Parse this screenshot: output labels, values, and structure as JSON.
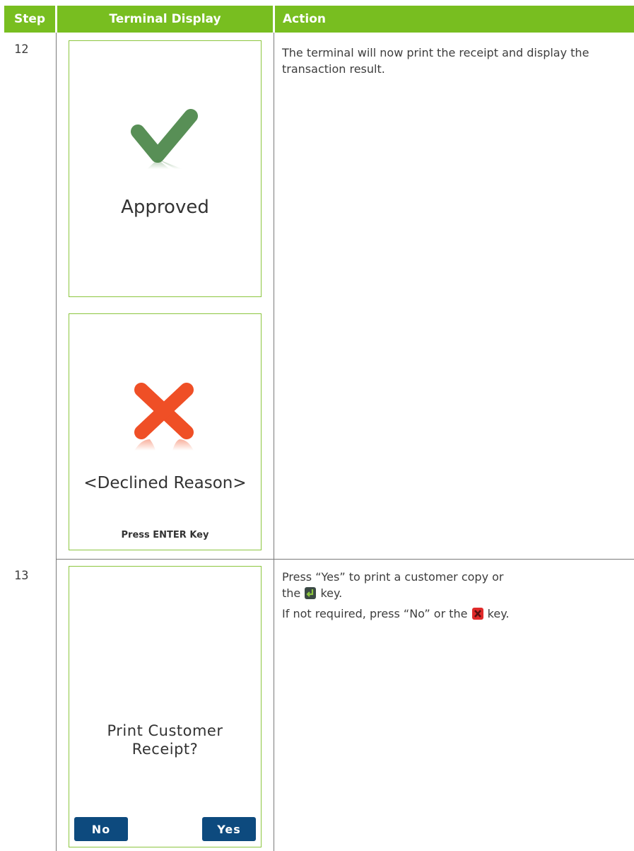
{
  "header": {
    "step": "Step",
    "terminal_display": "Terminal Display",
    "action": "Action"
  },
  "rows": [
    {
      "step": "12",
      "screens": [
        {
          "icon": "checkmark-icon",
          "message": "Approved"
        },
        {
          "icon": "cross-icon",
          "message": "<Declined Reason>",
          "footer": "Press ENTER Key"
        }
      ],
      "action_lines": [
        "The terminal will now print the receipt and display the transaction result."
      ]
    },
    {
      "step": "13",
      "screen": {
        "message_line1": "Print Customer",
        "message_line2": "Receipt?",
        "buttons": {
          "no": "No",
          "yes": "Yes"
        }
      },
      "action": {
        "line1_before": "Press “Yes” to print a customer copy or",
        "line2_before": "the",
        "line2_after": "key.",
        "line3_before": "If not required, press “No” or the",
        "line3_after": "key."
      }
    }
  ],
  "colors": {
    "header": "#78be20",
    "screen_border": "#8cc63f",
    "check": "#4f8a4d",
    "cross": "#f04e23",
    "button": "#0d4a7e",
    "enter_key": "#3b4a45",
    "cancel_key": "#e02a2a"
  }
}
